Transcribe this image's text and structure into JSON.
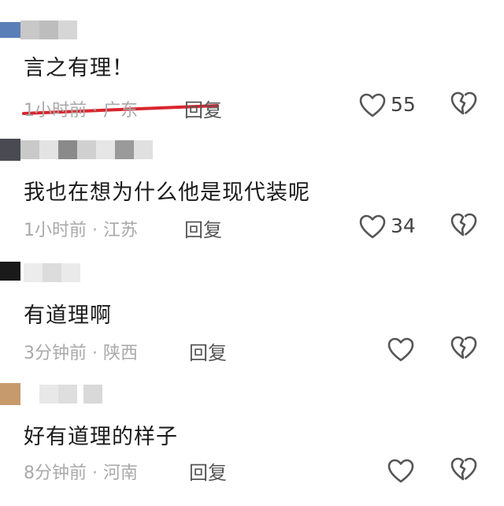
{
  "comments": [
    {
      "text": "言之有理！",
      "meta": "1小时前 · 广东",
      "reply": "回复",
      "likes": "55",
      "avatar_color": "#5a7fb8",
      "name_blocks": [
        "#c8c8c8",
        "#bdbdbd",
        "#d6d6d6"
      ],
      "underline_color": "#d8262e"
    },
    {
      "text": "我也在想为什么他是现代装呢",
      "meta": "1小时前 · 江苏",
      "reply": "回复",
      "likes": "34",
      "avatar_color": "#4a4a52",
      "name_blocks": [
        "#c9c9c9",
        "#e3e3e3",
        "#8a8a8a",
        "#d0d0d0",
        "#e6e6e6",
        "#9a9a9a",
        "#e0e0e0"
      ]
    },
    {
      "text": "有道理啊",
      "meta": "3分钟前 · 陕西",
      "reply": "回复",
      "likes": "",
      "avatar_color": "#1a1a1a",
      "name_blocks": [
        "#ececec",
        "#dcdcdc",
        "#eaeaea"
      ]
    },
    {
      "text": "好有道理的样子",
      "meta": "8分钟前 · 河南",
      "reply": "回复",
      "likes": "",
      "avatar_color": "#c79a6e",
      "name_blocks": [
        "#e8e8e8",
        "#dedede",
        "#d9d9d9"
      ]
    }
  ],
  "icons": {
    "like": "heart-outline-icon",
    "dislike": "broken-heart-icon"
  },
  "colors": {
    "text": "#1a1a1a",
    "meta": "#a9a9a9",
    "icon": "#555555"
  }
}
